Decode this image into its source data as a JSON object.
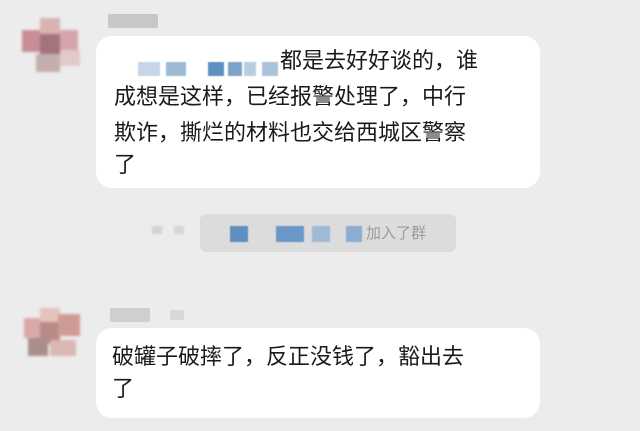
{
  "messages": [
    {
      "lines": [
        "都是去好好谈的，谁",
        "成想是这样，已经报警处理了，中行",
        "欺诈，撕烂的材料也交给西城区警察",
        "了"
      ]
    },
    {
      "lines": [
        "破罐子破摔了，反正没钱了，豁出去",
        "了"
      ]
    }
  ],
  "system_notice": {
    "text": "加入了群"
  }
}
